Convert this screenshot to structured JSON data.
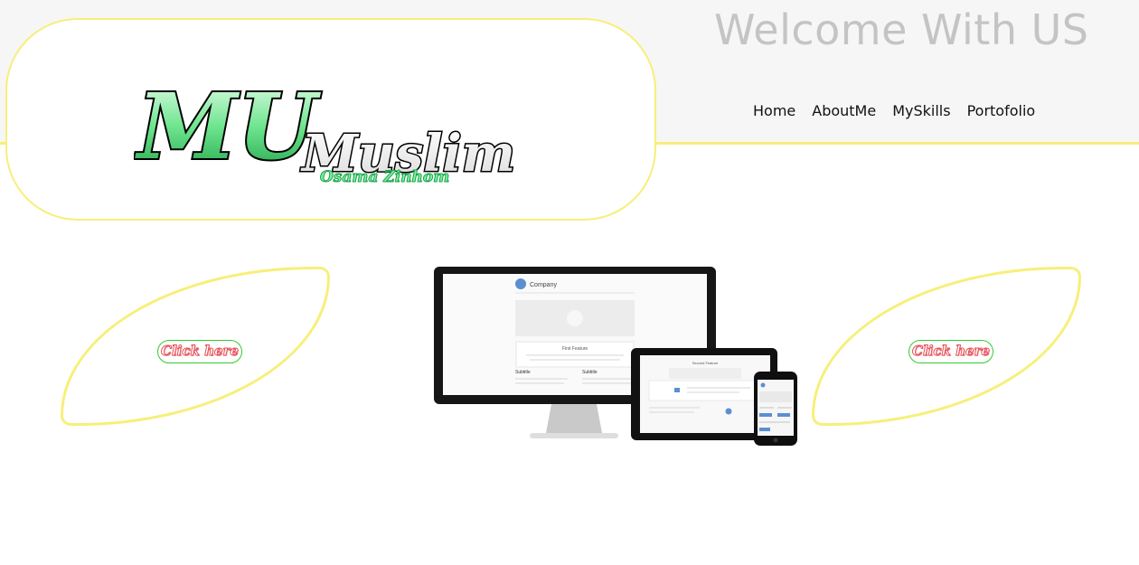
{
  "logo": {
    "monogram": "MU",
    "name": "Muslim",
    "subtitle": "Osama Zinhom"
  },
  "header": {
    "welcome": "Welcome With US"
  },
  "nav": {
    "items": [
      {
        "label": "Home"
      },
      {
        "label": "AboutMe"
      },
      {
        "label": "MySkills"
      },
      {
        "label": "Portofolio"
      }
    ]
  },
  "cards": {
    "left_button": "Click here",
    "right_button": "Click here"
  },
  "mockup": {
    "company": "Company",
    "feature": "First Feature",
    "subtitle_a": "Subtitle",
    "subtitle_b": "Subtitle",
    "tablet_heading": "Second Feature"
  },
  "colors": {
    "accent_yellow": "#f7ef7a",
    "logo_green": "#6fe58f",
    "button_red": "#e5535a",
    "button_border": "#33cc33",
    "welcome_gray": "#c4c4c4"
  }
}
